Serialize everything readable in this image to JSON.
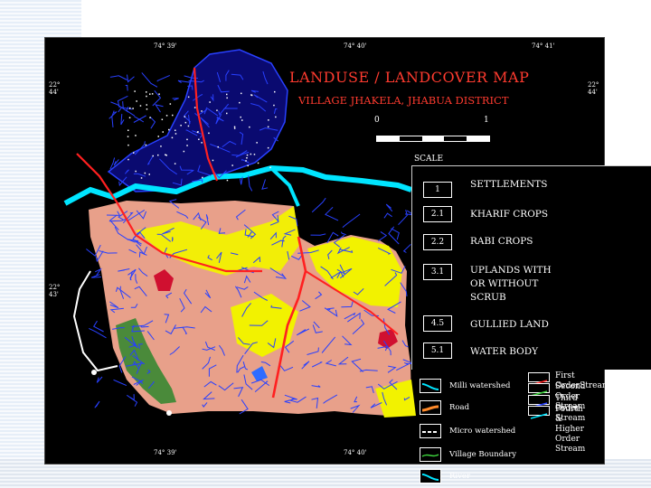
{
  "title": "LANDUSE / LANDCOVER  MAP",
  "subtitle": "VILLAGE JHAKELA, JHABUA DISTRICT",
  "scale": {
    "start": "0",
    "end": "1",
    "label": "SCALE"
  },
  "coordinates": {
    "top": [
      "74° 39'",
      "74° 40'",
      "74° 41'"
    ],
    "bottom": [
      "74° 39'",
      "74° 40'"
    ],
    "left": [
      "22°\n44'",
      "22°\n43'"
    ],
    "right": [
      "22°\n44'"
    ]
  },
  "landuse_classes": [
    {
      "code": "1",
      "label": "SETTLEMENTS"
    },
    {
      "code": "2.1",
      "label": "KHARIF CROPS"
    },
    {
      "code": "2.2",
      "label": "RABI CROPS"
    },
    {
      "code": "3.1",
      "label": "UPLANDS WITH\nOR WITHOUT\nSCRUB"
    },
    {
      "code": "4.5",
      "label": "GULLIED LAND"
    },
    {
      "code": "5.1",
      "label": "WATER BODY"
    }
  ],
  "symbol_legend": [
    {
      "label": "Milli watershed",
      "icon": "cyan-line-icon",
      "color": "#00e5ff"
    },
    {
      "label": "Road",
      "icon": "road-line-icon",
      "color": "#ff8a2a"
    },
    {
      "label": "Micro watershed",
      "icon": "dashed-line-icon",
      "color": "#ffffff"
    },
    {
      "label": "Village Boundary",
      "icon": "green-line-icon",
      "color": "#3cd23c"
    },
    {
      "label": "River",
      "icon": "river-line-icon",
      "color": "#00e5ff"
    }
  ],
  "stream_legend": [
    {
      "label": "First OrderStream",
      "color": "#ff2020"
    },
    {
      "label": "Second Order Stream",
      "color": "#3cd23c"
    },
    {
      "label": "Third Order Stream",
      "color": "#2840ff"
    },
    {
      "label": "Fourth & Higher\nOrder Stream",
      "color": "#00e5ff"
    }
  ],
  "colors": {
    "kharif": "#e8a08a",
    "rabi": "#f2f200",
    "settlement_zone": "#0a0a70",
    "upland_scrub": "#4a8a3a",
    "water": "#00e5ff",
    "gullied": "#d01030",
    "first_order_stream": "#ff2020",
    "third_order_stream": "#2840ff"
  }
}
